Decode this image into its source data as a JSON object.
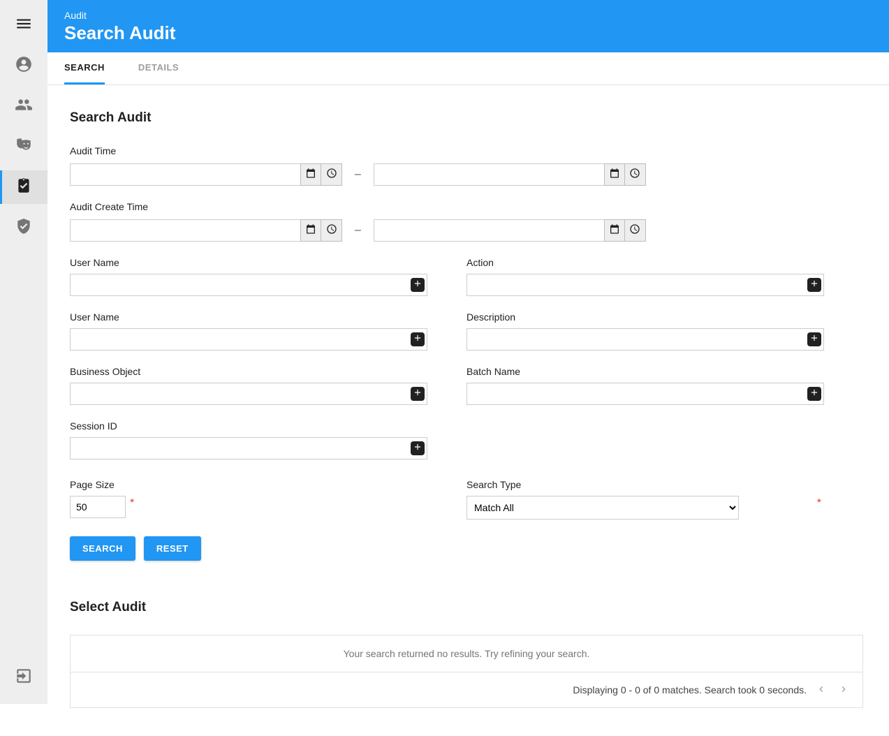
{
  "header": {
    "crumb": "Audit",
    "title": "Search Audit"
  },
  "tabs": {
    "search": "SEARCH",
    "details": "DETAILS"
  },
  "section": {
    "searchAudit": "Search Audit",
    "selectAudit": "Select Audit"
  },
  "labels": {
    "auditTime": "Audit Time",
    "auditCreateTime": "Audit Create Time",
    "userName1": "User Name",
    "userName2": "User Name",
    "businessObject": "Business Object",
    "sessionId": "Session ID",
    "action": "Action",
    "description": "Description",
    "batchName": "Batch Name",
    "pageSize": "Page Size",
    "searchType": "Search Type",
    "dash": "–"
  },
  "values": {
    "pageSize": "50",
    "searchType": "Match All",
    "auditTimeFrom": "",
    "auditTimeTo": "",
    "auditCreateFrom": "",
    "auditCreateTo": "",
    "userName1": "",
    "userName2": "",
    "businessObject": "",
    "sessionId": "",
    "action": "",
    "description": "",
    "batchName": ""
  },
  "buttons": {
    "search": "SEARCH",
    "reset": "RESET"
  },
  "results": {
    "empty": "Your search returned no results. Try refining your search.",
    "footer": "Displaying 0 - 0 of 0 matches. Search took 0 seconds."
  },
  "required": "*"
}
